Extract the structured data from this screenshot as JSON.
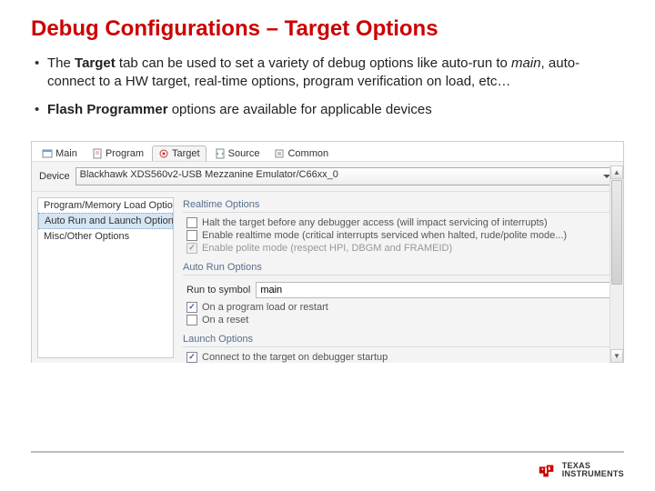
{
  "title": "Debug Configurations – Target Options",
  "bullets": {
    "b1_pre": "The ",
    "b1_bold": "Target",
    "b1_mid": " tab can be used to set a variety of debug options like auto-run to ",
    "b1_em": "main",
    "b1_post": ", auto-connect to a HW target, real-time options, program verification on load, etc…",
    "b2_bold": "Flash Programmer",
    "b2_post": " options are available for applicable devices"
  },
  "tabs": {
    "main": "Main",
    "program": "Program",
    "target": "Target",
    "source": "Source",
    "common": "Common"
  },
  "device": {
    "label": "Device",
    "value": "Blackhawk XDS560v2-USB Mezzanine Emulator/C66xx_0"
  },
  "sidebar": {
    "items": [
      "Program/Memory Load Options",
      "Auto Run and Launch Options",
      "Misc/Other Options"
    ]
  },
  "groups": {
    "realtime": {
      "title": "Realtime Options",
      "opt1": "Halt the target before any debugger access (will impact servicing of interrupts)",
      "opt2": "Enable realtime mode (critical interrupts serviced when halted, rude/polite mode...)",
      "opt3": "Enable polite mode (respect HPI, DBGM and FRAMEID)"
    },
    "autorun": {
      "title": "Auto Run Options",
      "run_label": "Run to symbol",
      "run_value": "main",
      "opt1": "On a program load or restart",
      "opt2": "On a reset"
    },
    "launch": {
      "title": "Launch Options",
      "opt1": "Connect to the target on debugger startup"
    }
  },
  "logo": {
    "line1": "TEXAS",
    "line2": "INSTRUMENTS"
  }
}
